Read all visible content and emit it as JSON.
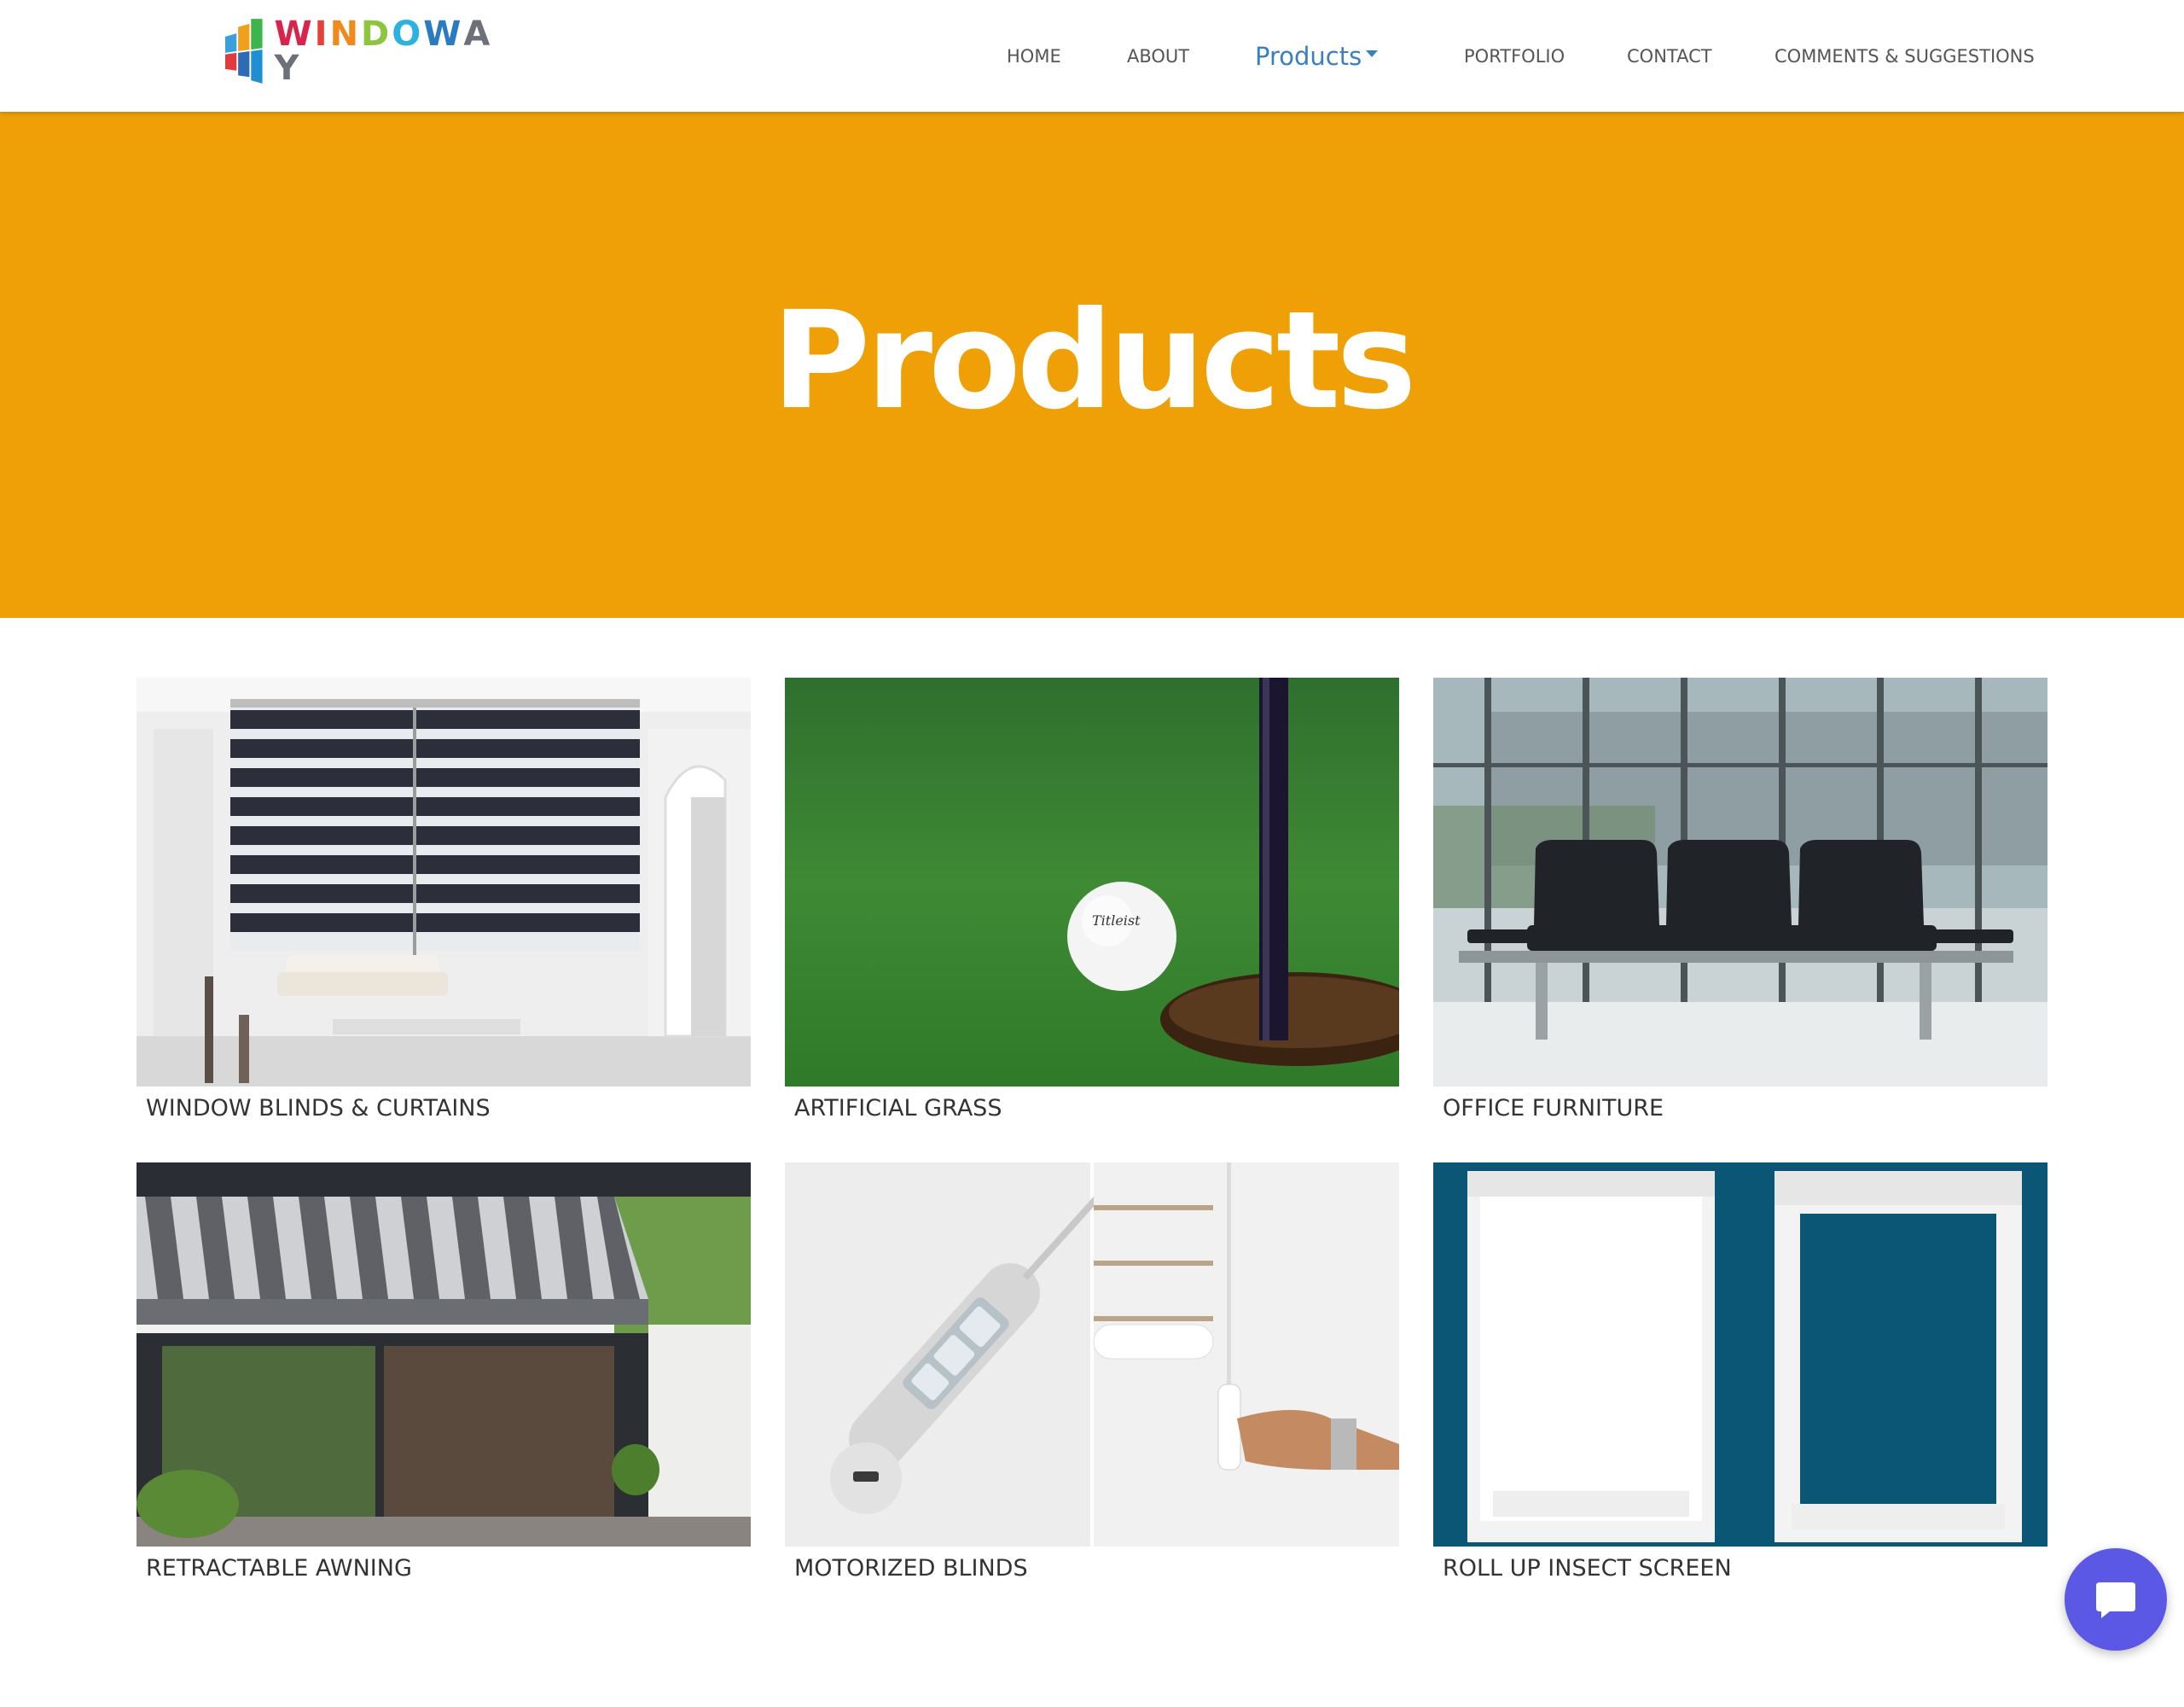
{
  "brand": {
    "logo_text": "WINDOWAY"
  },
  "nav": {
    "home": "HOME",
    "about": "ABOUT",
    "products": "Products",
    "portfolio": "PORTFOLIO",
    "contact": "CONTACT",
    "comments": "COMMENTS & SUGGESTIONS"
  },
  "hero": {
    "title": "Products"
  },
  "products": [
    {
      "label": "WINDOW BLINDS & CURTAINS",
      "image": "zebra-blinds-living-room"
    },
    {
      "label": "ARTIFICIAL GRASS",
      "image": "golf-ball-hole-grass"
    },
    {
      "label": "OFFICE FURNITURE",
      "image": "waiting-room-chairs"
    },
    {
      "label": "RETRACTABLE AWNING",
      "image": "striped-awning-patio"
    },
    {
      "label": "MOTORIZED BLINDS",
      "image": "motor-remote-handle"
    },
    {
      "label": "ROLL UP INSECT SCREEN",
      "image": "insect-screen-frames"
    }
  ],
  "colors": {
    "hero_bg": "#f0a007",
    "nav_active": "#3a7fc0",
    "chat_button": "#5b58e6"
  },
  "icons": {
    "chat": "chat-bubble-icon",
    "dropdown": "caret-down-icon"
  }
}
